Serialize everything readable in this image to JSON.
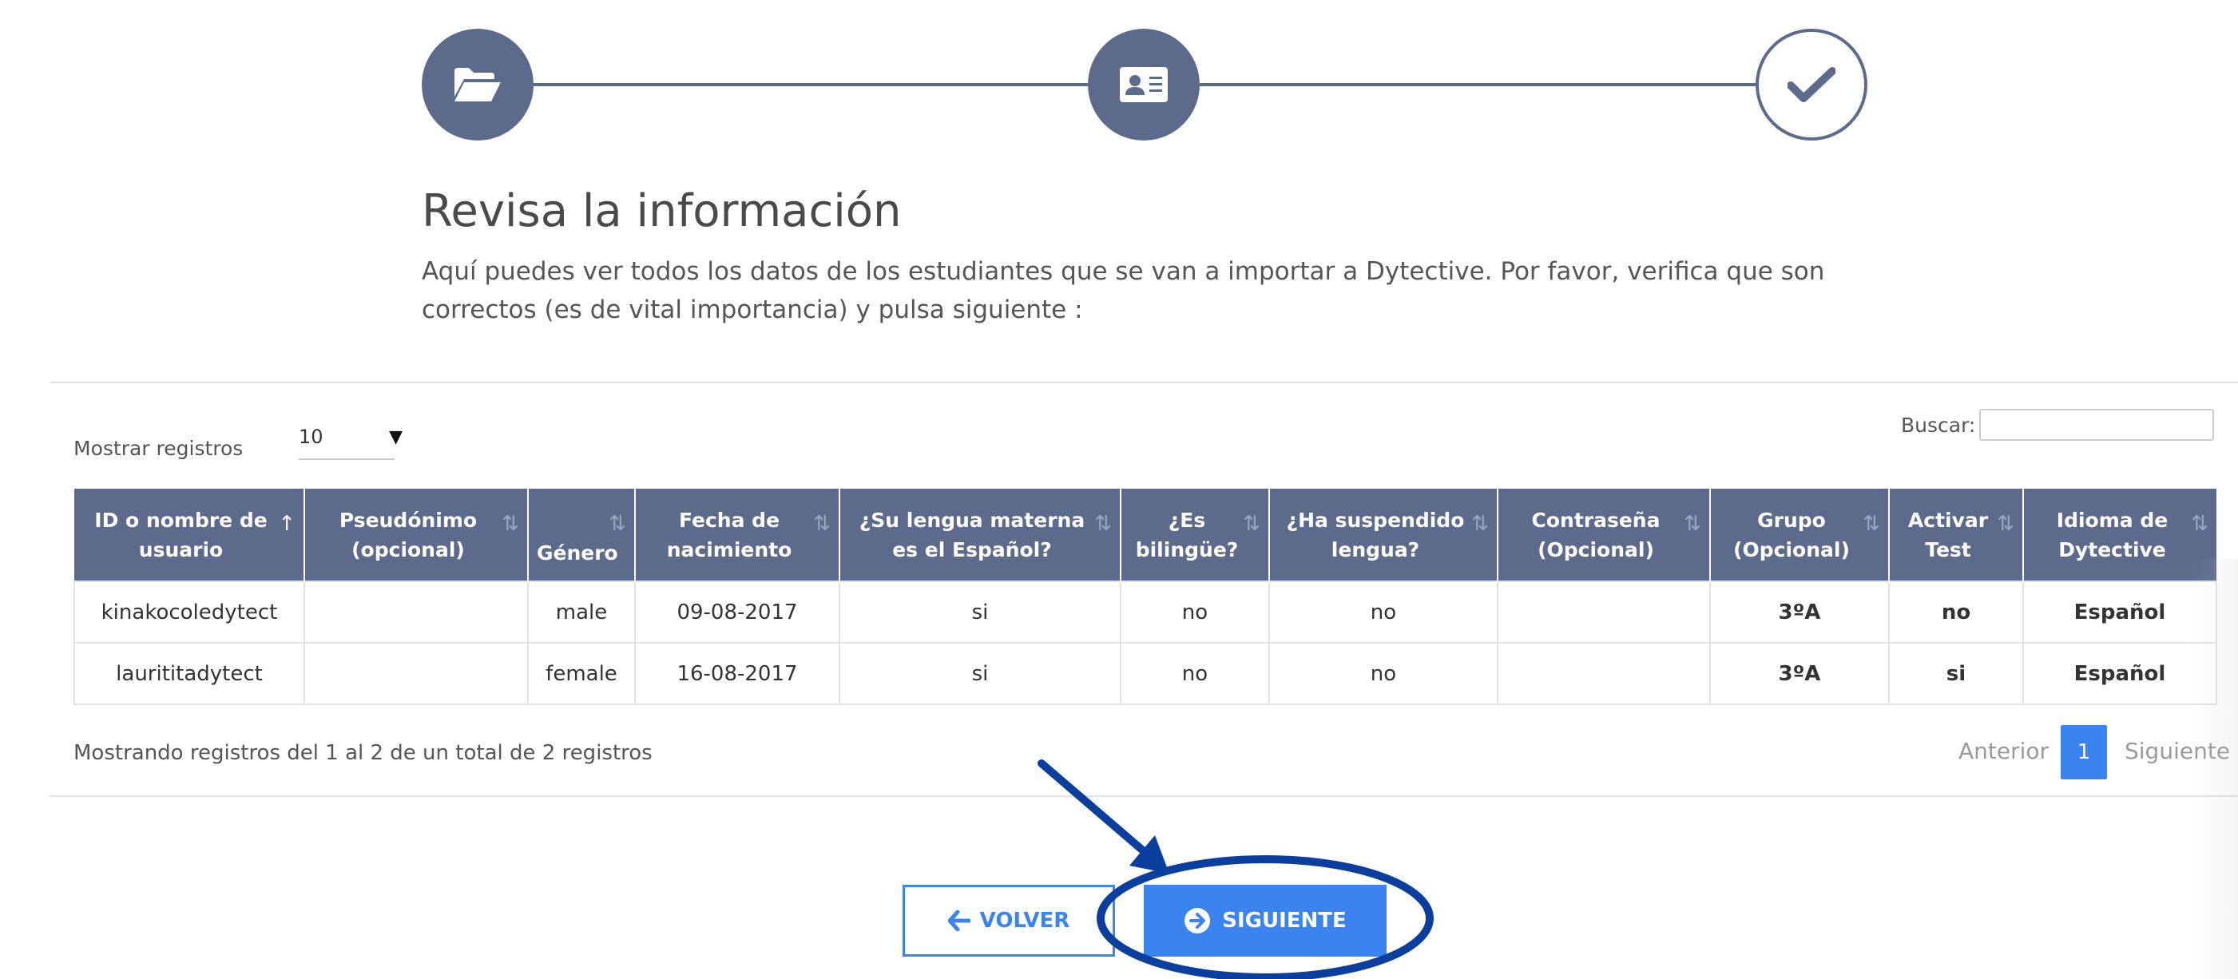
{
  "stepper": {
    "steps": [
      {
        "icon": "folder-open-icon",
        "state": "done"
      },
      {
        "icon": "id-card-icon",
        "state": "done"
      },
      {
        "icon": "check-icon",
        "state": "current"
      }
    ],
    "color": "#5c6b8c"
  },
  "heading": "Revisa la información",
  "description": "Aquí puedes ver todos los datos de los estudiantes que se van a importar a Dytective. Por favor, verifica que son correctos (es de vital importancia) y pulsa siguiente :",
  "controls": {
    "show_label": "Mostrar registros",
    "show_value": "10",
    "search_label": "Buscar:",
    "search_value": ""
  },
  "table": {
    "columns": [
      "ID o nombre de usuario",
      "Pseudónimo (opcional)",
      "Género",
      "Fecha de nacimiento",
      "¿Su lengua materna es el Español?",
      "¿Es bilingüe?",
      "¿Ha suspendido lengua?",
      "Contraseña (Opcional)",
      "Grupo (Opcional)",
      "Activar Test",
      "Idioma de Dytective"
    ],
    "rows": [
      [
        "kinakocoledytect",
        "",
        "male",
        "09-08-2017",
        "si",
        "no",
        "no",
        "",
        "3ºA",
        "no",
        "Español"
      ],
      [
        "laurititadytect",
        "",
        "female",
        "16-08-2017",
        "si",
        "no",
        "no",
        "",
        "3ºA",
        "si",
        "Español"
      ]
    ]
  },
  "footer": {
    "info": "Mostrando registros del 1 al 2 de un total de 2 registros",
    "prev": "Anterior",
    "page": "1",
    "next": "Siguiente"
  },
  "buttons": {
    "back": "VOLVER",
    "next": "SIGUIENTE"
  },
  "colors": {
    "header": "#5c6b8c",
    "accent": "#3b83ee",
    "annotation": "#0a3fa0"
  }
}
